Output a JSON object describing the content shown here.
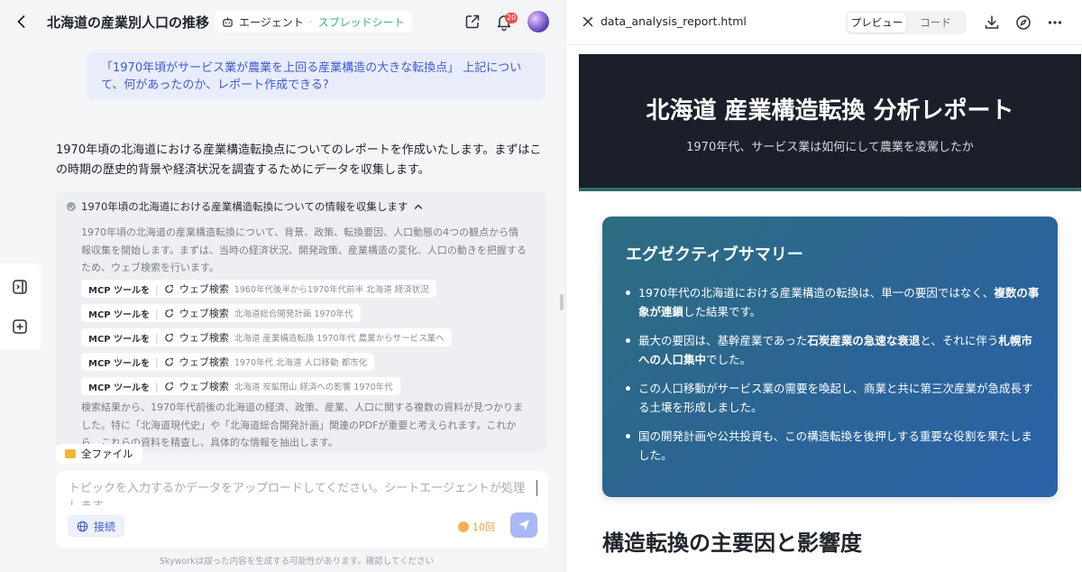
{
  "header": {
    "title": "北海道の産業別人口の推移",
    "agent_label": "エージェント",
    "mode_label": "スプレッドシート",
    "notification_count": "20"
  },
  "user_message": "「1970年頃がサービス業が農業を上回る産業構造の大きな転換点」 上記について、何があったのか、レポート作成できる?",
  "assistant_message": "1970年頃の北海道における産業構造転換点についてのレポートを作成いたします。まずはこの時期の歴史的背景や経済状況を調査するためにデータを収集します。",
  "task": {
    "title": "1970年頃の北海道における産業構造転換についての情報を収集します",
    "description": "1970年頃の北海道の産業構造転換について、背景、政策、転換要因、人口動態の4つの観点から情報収集を開始します。まずは、当時の経済状況、開発政策、産業構造の変化、人口の動きを把握するため、ウェブ検索を行います。",
    "tool_calls": [
      {
        "tool": "MCP ツールを",
        "action": "ウェブ検索",
        "query": "1960年代後半から1970年代前半 北海道 経済状況"
      },
      {
        "tool": "MCP ツールを",
        "action": "ウェブ検索",
        "query": "北海道総合開発計画 1970年代"
      },
      {
        "tool": "MCP ツールを",
        "action": "ウェブ検索",
        "query": "北海道 産業構造転換 1970年代 農業からサービス業へ"
      },
      {
        "tool": "MCP ツールを",
        "action": "ウェブ検索",
        "query": "1970年代 北海道 人口移動 都市化"
      },
      {
        "tool": "MCP ツールを",
        "action": "ウェブ検索",
        "query": "北海道 炭鉱閉山 経済への影響 1970年代"
      }
    ],
    "result": "検索結果から、1970年代前後の北海道の経済、政策、産業、人口に関する複数の資料が見つかりました。特に「北海道現代史」や「北海道総合開発計画」関連のPDFが重要と考えられます。これから、これらの資料を精査し、具体的な情報を抽出します。"
  },
  "files_label": "全ファイル",
  "input": {
    "placeholder": "トピックを入力するかデータをアップロードしてください。シートエージェントが処理します",
    "connect_label": "接続",
    "credits": "10回"
  },
  "disclaimer": "Skyworkは誤った内容を生成する可能性があります。確認してください",
  "preview": {
    "filename": "data_analysis_report.html",
    "tab_preview": "プレビュー",
    "tab_code": "コード",
    "report_title": "北海道 産業構造転換 分析レポート",
    "report_subtitle": "1970年代、サービス業は如何にして農業を凌駕したか",
    "summary_title": "エグゼクティブサマリー",
    "summary_items": [
      {
        "before": "1970年代の北海道における産業構造の転換は、単一の要因ではなく、",
        "bold": "複数の事象が連鎖",
        "after": "した結果です。",
        "bold2": "",
        "after2": ""
      },
      {
        "before": "最大の要因は、基幹産業であった",
        "bold": "石炭産業の急速な衰退",
        "after": "と、それに伴う",
        "bold2": "札幌市への人口集中",
        "after2": "でした。"
      },
      {
        "before": "この人口移動がサービス業の需要を喚起し、商業と共に第三次産業が急成長する土壌を形成しました。",
        "bold": "",
        "after": "",
        "bold2": "",
        "after2": ""
      },
      {
        "before": "国の開発計画や公共投資も、この構造転換を後押しする重要な役割を果たしました。",
        "bold": "",
        "after": "",
        "bold2": "",
        "after2": ""
      }
    ],
    "section_title": "構造転換の主要因と影響度"
  }
}
